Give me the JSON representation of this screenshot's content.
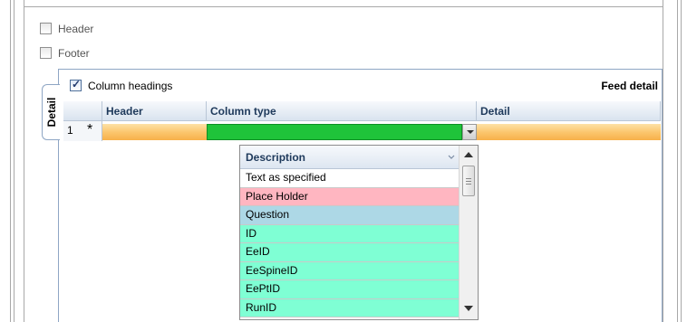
{
  "options": {
    "header": {
      "label": "Header",
      "checked": false
    },
    "footer": {
      "label": "Footer",
      "checked": false
    }
  },
  "detail_panel": {
    "tab_label": "Detail",
    "column_headings": {
      "label": "Column headings",
      "checked": true
    },
    "title": "Feed detail"
  },
  "grid": {
    "columns": [
      "Header",
      "Column type",
      "Detail"
    ],
    "row": {
      "number": "1",
      "marker": "*"
    }
  },
  "dropdown": {
    "header": "Description",
    "items": [
      {
        "label": "Text as specified",
        "color": "#ffffff"
      },
      {
        "label": "Place Holder",
        "color": "#ffb6c1"
      },
      {
        "label": "Question",
        "color": "#add8e6"
      },
      {
        "label": "ID",
        "color": "#7fffd4"
      },
      {
        "label": "EeID",
        "color": "#7fffd4"
      },
      {
        "label": "EeSpineID",
        "color": "#7fffd4"
      },
      {
        "label": "EePtID",
        "color": "#7fffd4"
      },
      {
        "label": "RunID",
        "color": "#7fffd4"
      }
    ]
  },
  "colors": {
    "accent_border": "#8ea6c4",
    "selected_cell": "#1fc33a",
    "new_row": "#fbc46a"
  }
}
